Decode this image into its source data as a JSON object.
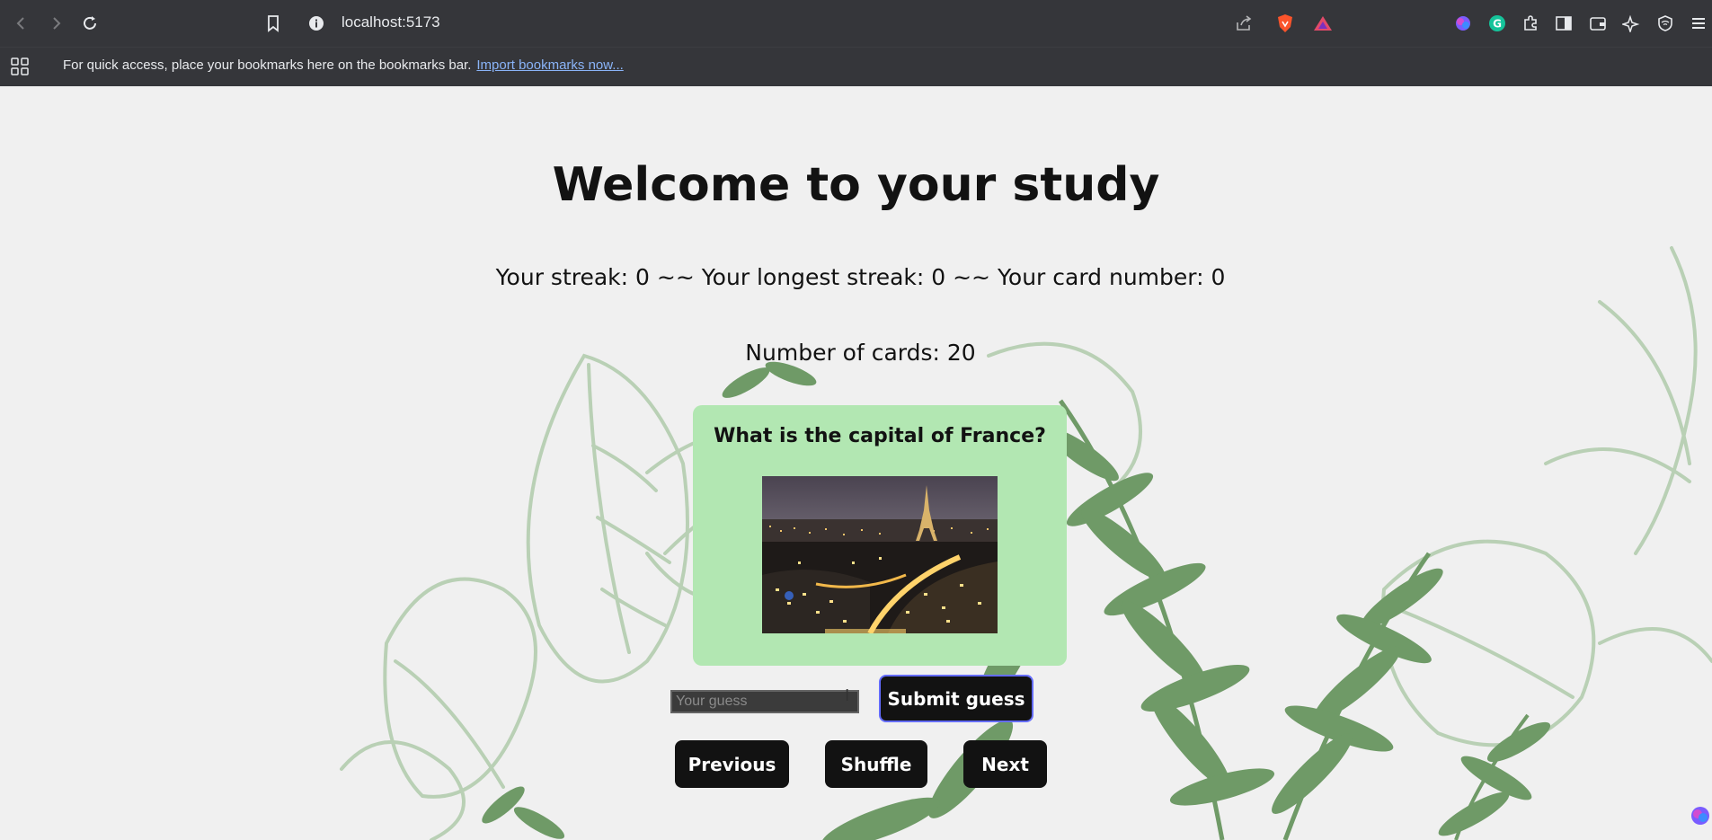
{
  "browser": {
    "url": "localhost:5173",
    "bookmarks_bar_text": "For quick access, place your bookmarks here on the bookmarks bar.",
    "bookmarks_import_link": "Import bookmarks now..."
  },
  "page": {
    "title": "Welcome to your study",
    "stats_line": "Your streak: 0 ~~ Your longest streak: 0 ~~ Your card number: 0",
    "card_count_line": "Number of cards: 20",
    "card": {
      "question": "What is the capital of France?",
      "image_name": "paris-night-skyline-image"
    },
    "guess_placeholder": "Your guess",
    "buttons": {
      "submit": "Submit guess",
      "previous": "Previous",
      "shuffle": "Shuffle",
      "next": "Next"
    }
  },
  "colors": {
    "card_bg": "#b2e7b2",
    "button_bg": "#121212",
    "submit_border": "#646cff",
    "leaf_green": "#6f9a67",
    "leaf_outline": "#b9d0b5"
  }
}
